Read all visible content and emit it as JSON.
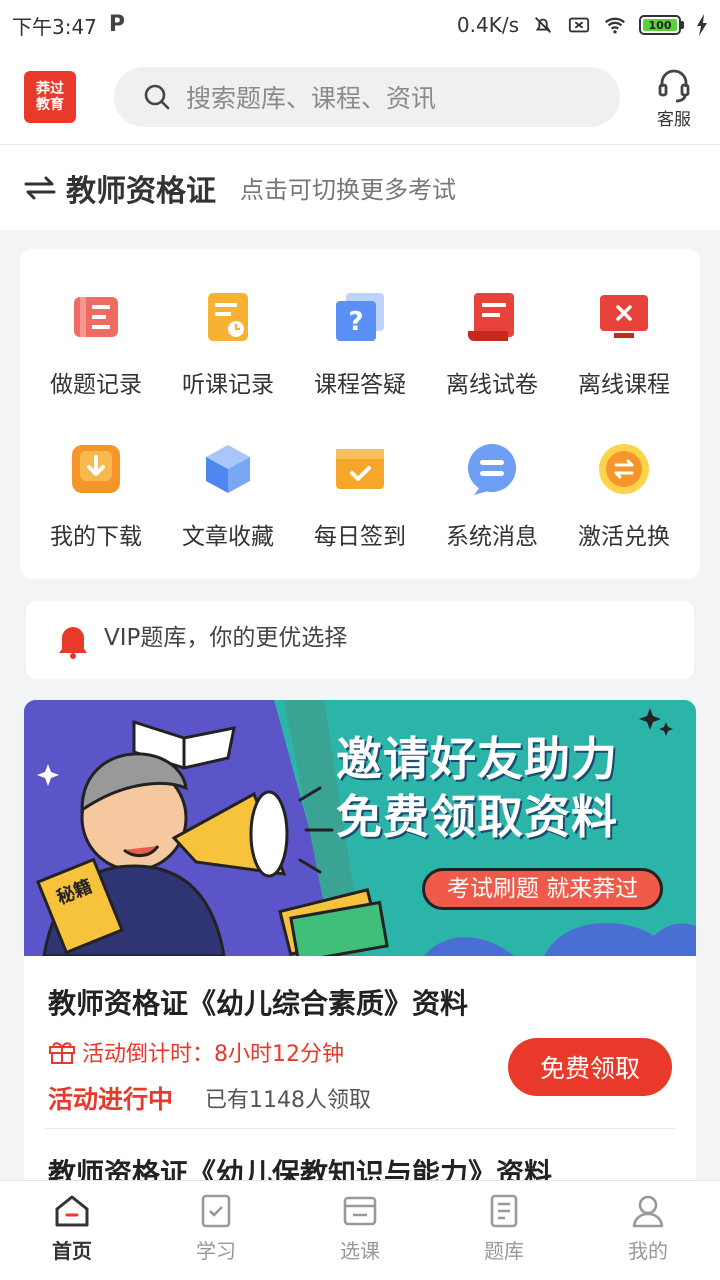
{
  "status_bar": {
    "time": "下午3:47",
    "speed": "0.4K/s",
    "battery": "100"
  },
  "header": {
    "logo_line1": "莽过",
    "logo_line2": "教育",
    "search_placeholder": "搜索题库、课程、资讯",
    "service_label": "客服"
  },
  "exam": {
    "title": "教师资格证",
    "hint": "点击可切换更多考试"
  },
  "grid": {
    "row1": [
      {
        "label": "做题记录",
        "icon": "exercise-record-icon"
      },
      {
        "label": "听课记录",
        "icon": "lecture-record-icon"
      },
      {
        "label": "课程答疑",
        "icon": "course-qa-icon"
      },
      {
        "label": "离线试卷",
        "icon": "offline-paper-icon"
      },
      {
        "label": "离线课程",
        "icon": "offline-course-icon"
      }
    ],
    "row2": [
      {
        "label": "我的下载",
        "icon": "download-icon"
      },
      {
        "label": "文章收藏",
        "icon": "favorite-articles-icon"
      },
      {
        "label": "每日签到",
        "icon": "daily-checkin-icon"
      },
      {
        "label": "系统消息",
        "icon": "system-message-icon"
      },
      {
        "label": "激活兑换",
        "icon": "activate-exchange-icon"
      }
    ]
  },
  "notice": {
    "text": "VIP题库，你的更优选择"
  },
  "banner": {
    "line1": "邀请好友助力",
    "line2": "免费领取资料",
    "pill": "考试刷题 就来莽过",
    "book_text": "秘籍"
  },
  "activity": {
    "title": "教师资格证《幼儿综合素质》资料",
    "countdown_label": "活动倒计时：",
    "countdown_value": "8小时12分钟",
    "status": "活动进行中",
    "claimed": "已有1148人领取",
    "button": "免费领取",
    "next_title": "教师资格证《幼儿保教知识与能力》资料"
  },
  "tabs": [
    {
      "label": "首页",
      "active": true
    },
    {
      "label": "学习",
      "active": false
    },
    {
      "label": "选课",
      "active": false
    },
    {
      "label": "题库",
      "active": false
    },
    {
      "label": "我的",
      "active": false
    }
  ],
  "colors": {
    "accent": "#e8392a",
    "banner_bg": "#2bb5a8"
  }
}
